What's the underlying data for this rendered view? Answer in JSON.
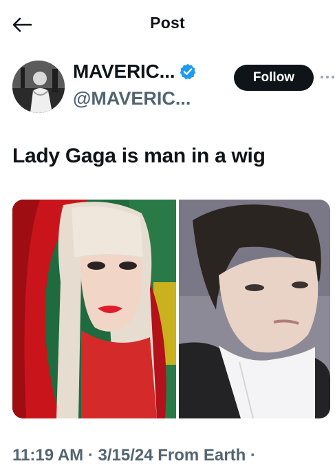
{
  "header": {
    "title": "Post"
  },
  "author": {
    "display_name": "MAVERIC...",
    "handle": "@MAVERIC...",
    "verified": true,
    "follow_label": "Follow"
  },
  "post": {
    "text": "Lady Gaga is man in a wig",
    "media": [
      {
        "description_icon": "photo-left"
      },
      {
        "description_icon": "photo-right"
      }
    ]
  },
  "meta": {
    "time": "11:19 AM",
    "separator": " · ",
    "date": "3/15/24",
    "source": "From Earth",
    "trailing_dot": " ·"
  },
  "colors": {
    "accent": "#1d9bf0",
    "text_primary": "#0f1419",
    "text_secondary": "#536471",
    "follow_bg": "#0f1419"
  }
}
